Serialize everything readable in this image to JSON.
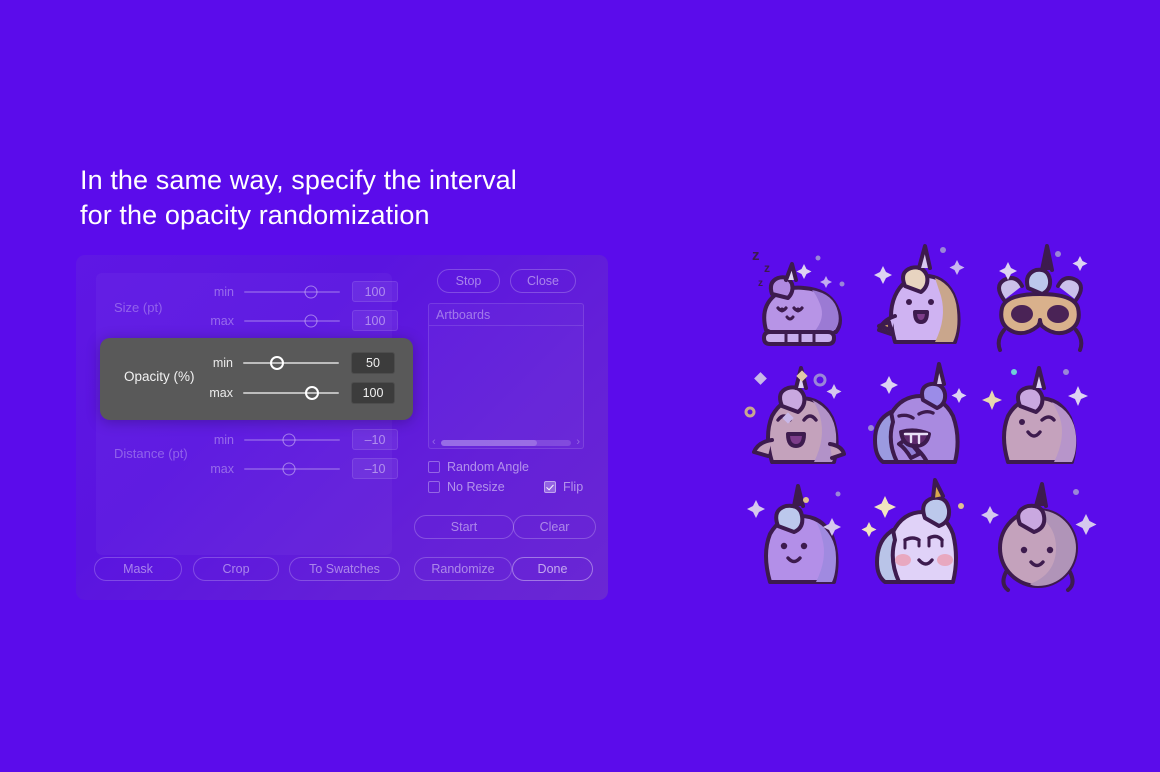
{
  "theme": {
    "background": "#5b0ceb",
    "panel_gradient_from": "#5f17e4",
    "panel_gradient_to": "#6a27d4",
    "highlight_bg": "#595959",
    "highlight_field_bg": "#3c3c3c",
    "text_on_purple": "#ffffff"
  },
  "headline": {
    "line1": "In the same way, specify the interval",
    "line2": "for the opacity randomization"
  },
  "panel": {
    "groups": [
      {
        "label": "Size (pt)",
        "rows": [
          {
            "name": "min",
            "value": "100",
            "thumb_pct": 70
          },
          {
            "name": "max",
            "value": "100",
            "thumb_pct": 70
          }
        ]
      },
      {
        "label": "Distance (pt)",
        "rows": [
          {
            "name": "min",
            "value": "–10",
            "thumb_pct": 47
          },
          {
            "name": "max",
            "value": "–10",
            "thumb_pct": 47
          }
        ]
      }
    ],
    "highlight": {
      "label": "Opacity (%)",
      "rows": [
        {
          "name": "min",
          "value": "50",
          "thumb_pct": 35
        },
        {
          "name": "max",
          "value": "100",
          "thumb_pct": 72
        }
      ]
    },
    "top_buttons": [
      {
        "label": "Stop"
      },
      {
        "label": "Close"
      }
    ],
    "artboards": {
      "header": "Artboards",
      "scroll_left_arrow": "‹",
      "scroll_right_arrow": "›"
    },
    "checkboxes": [
      {
        "label": "Random Angle",
        "checked": false
      },
      {
        "label": "No Resize",
        "checked": false
      },
      {
        "label": "Flip",
        "checked": true
      }
    ],
    "action_buttons": [
      {
        "label": "Start"
      },
      {
        "label": "Clear"
      },
      {
        "label": "Randomize"
      },
      {
        "label": "Done"
      }
    ],
    "bottom_buttons": [
      {
        "label": "Mask"
      },
      {
        "label": "Crop"
      },
      {
        "label": "To Swatches"
      }
    ]
  },
  "artwork": {
    "title": "unicorn-sticker-grid",
    "items": [
      {
        "name": "sleeping-unicorn"
      },
      {
        "name": "happy-waving-unicorn"
      },
      {
        "name": "unicorn-mask"
      },
      {
        "name": "laughing-unicorn"
      },
      {
        "name": "grinning-unicorn"
      },
      {
        "name": "winking-unicorn"
      },
      {
        "name": "smiling-unicorn"
      },
      {
        "name": "blushing-unicorn"
      },
      {
        "name": "round-unicorn"
      }
    ]
  }
}
